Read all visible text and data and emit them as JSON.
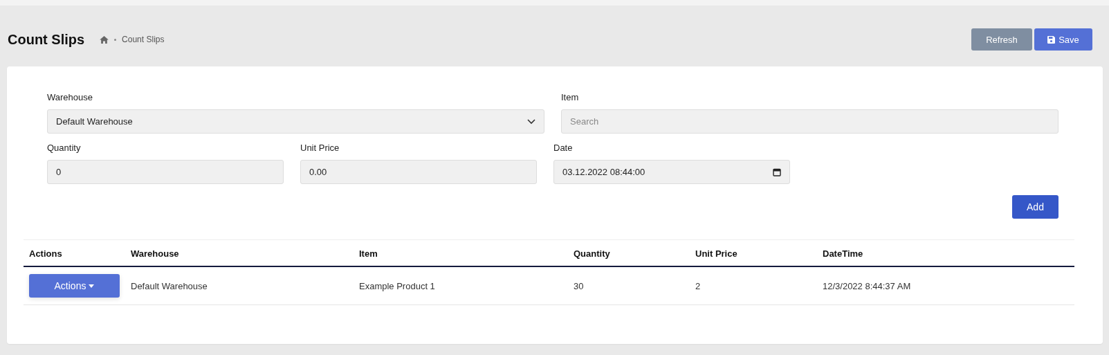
{
  "page": {
    "title": "Count Slips",
    "breadcrumb": "Count Slips"
  },
  "header_buttons": [
    {
      "kind": "plain",
      "label": "Refresh"
    },
    {
      "kind": "save",
      "label": "Save"
    }
  ],
  "form": {
    "warehouse": {
      "label": "Warehouse",
      "value": "Default Warehouse"
    },
    "item": {
      "label": "Item",
      "placeholder": "Search"
    },
    "quantity": {
      "label": "Quantity",
      "value": "0"
    },
    "unit_price": {
      "label": "Unit Price",
      "value": "0.00"
    },
    "date": {
      "label": "Date",
      "value": "03.12.2022 08:44:00"
    },
    "add_button": "Add"
  },
  "table": {
    "columns": [
      "Actions",
      "Warehouse",
      "Item",
      "Quantity",
      "Unit Price",
      "DateTime"
    ],
    "rows": [
      {
        "cells": [
          {
            "kind": "button",
            "text": "Actions"
          },
          {
            "kind": "text",
            "text": "Default Warehouse"
          },
          {
            "kind": "text",
            "text": "Example Product 1"
          },
          {
            "kind": "text",
            "text": "30"
          },
          {
            "kind": "text",
            "text": "2"
          },
          {
            "kind": "text",
            "text": "12/3/2022 8:44:37 AM"
          }
        ]
      }
    ]
  }
}
